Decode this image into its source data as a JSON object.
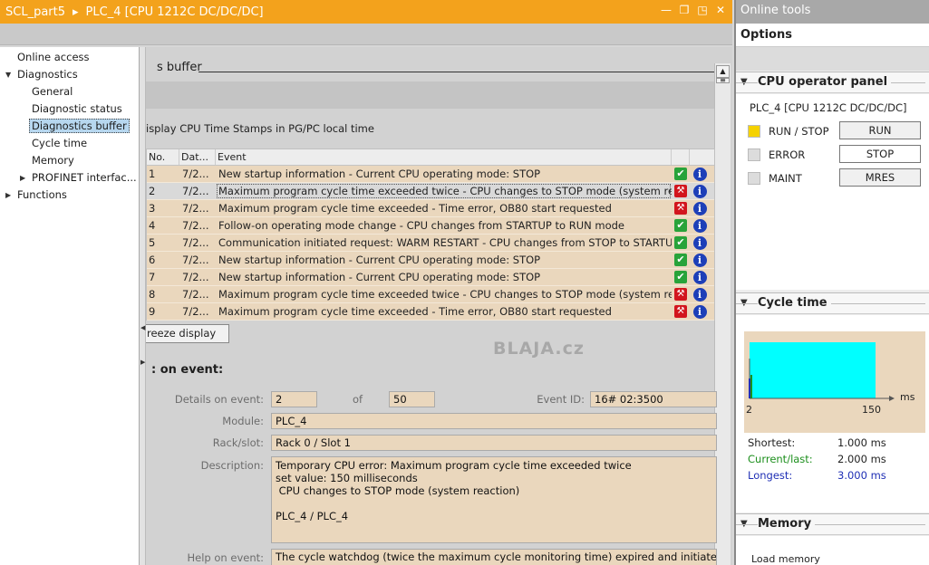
{
  "window": {
    "project": "SCL_part5",
    "device": "PLC_4 [CPU 1212C DC/DC/DC]",
    "controls": [
      "—",
      "❐",
      "◳",
      "✕"
    ]
  },
  "nav": {
    "items": [
      {
        "label": "Online access",
        "level": 0,
        "arrow": ""
      },
      {
        "label": "Diagnostics",
        "level": 0,
        "arrow": "▼"
      },
      {
        "label": "General",
        "level": 1,
        "arrow": ""
      },
      {
        "label": "Diagnostic status",
        "level": 1,
        "arrow": ""
      },
      {
        "label": "Diagnostics buffer",
        "level": 1,
        "arrow": "",
        "selected": true
      },
      {
        "label": "Cycle time",
        "level": 1,
        "arrow": ""
      },
      {
        "label": "Memory",
        "level": 1,
        "arrow": ""
      },
      {
        "label": "PROFINET interfac...",
        "level": 1,
        "arrow": "▶"
      },
      {
        "label": "Functions",
        "level": 0,
        "arrow": "▶"
      }
    ]
  },
  "main": {
    "section_title": "s buffer",
    "checkbox_label": "isplay CPU Time Stamps in PG/PC local time",
    "table": {
      "headers": {
        "no": "No.",
        "date": "Dat...",
        "event": "Event"
      },
      "rows": [
        {
          "no": "1",
          "date": "7/2...",
          "event": "New startup information  - Current CPU operating mode: STOP",
          "status": "ok"
        },
        {
          "no": "2",
          "date": "7/2...",
          "event": "Maximum program cycle time exceeded twice  - CPU changes to STOP mode (system reactio...",
          "status": "err",
          "selected": true
        },
        {
          "no": "3",
          "date": "7/2...",
          "event": "Maximum program cycle time exceeded  - Time error, OB80 start requested",
          "status": "err"
        },
        {
          "no": "4",
          "date": "7/2...",
          "event": "Follow-on operating mode change  - CPU changes from STARTUP to RUN mode",
          "status": "ok"
        },
        {
          "no": "5",
          "date": "7/2...",
          "event": "Communication initiated request: WARM RESTART  - CPU changes from STOP to STARTUP m...",
          "status": "ok"
        },
        {
          "no": "6",
          "date": "7/2...",
          "event": "New startup information  - Current CPU operating mode: STOP",
          "status": "ok"
        },
        {
          "no": "7",
          "date": "7/2...",
          "event": "New startup information  - Current CPU operating mode: STOP",
          "status": "ok"
        },
        {
          "no": "8",
          "date": "7/2...",
          "event": "Maximum program cycle time exceeded twice  - CPU changes to STOP mode (system reactio...",
          "status": "err"
        },
        {
          "no": "9",
          "date": "7/2...",
          "event": "Maximum program cycle time exceeded  - Time error, OB80 start requested",
          "status": "err"
        }
      ]
    },
    "freeze_button": "reeze display",
    "watermark": "BLAJA.cz",
    "details": {
      "title": ": on event:",
      "details_on_event_label": "Details on event:",
      "details_on_event_value": "2",
      "of_label": "of",
      "of_value": "50",
      "event_id_label": "Event ID:",
      "event_id_value": "16# 02:3500",
      "module_label": "Module:",
      "module_value": "PLC_4",
      "rack_label": "Rack/slot:",
      "rack_value": "Rack 0 / Slot 1",
      "description_label": "Description:",
      "description_value": "Temporary CPU error: Maximum program cycle time exceeded twice\nset value: 150 milliseconds\n CPU changes to STOP mode (system reaction)\n\nPLC_4 / PLC_4",
      "help_label": "Help on event:",
      "help_value": "The cycle watchdog (twice the maximum cycle monitoring time) expired and initiated an"
    }
  },
  "right": {
    "title": "Online tools",
    "options": "Options",
    "cpu_panel": {
      "title": "CPU operator panel",
      "cpu_name": "PLC_4 [CPU 1212C DC/DC/DC]",
      "leds": [
        {
          "label": "RUN / STOP",
          "color": "#f5d200",
          "button": "RUN"
        },
        {
          "label": "ERROR",
          "color": "#dcdcdc",
          "button": "STOP"
        },
        {
          "label": "MAINT",
          "color": "#dcdcdc",
          "button": "MRES"
        }
      ]
    },
    "cycle_time": {
      "title": "Cycle time",
      "unit": "ms",
      "axis_min": "2",
      "axis_max": "150",
      "shortest_label": "Shortest:",
      "shortest_value": "1.000 ms",
      "current_label": "Current/last:",
      "current_value": "2.000 ms",
      "longest_label": "Longest:",
      "longest_value": "3.000 ms",
      "colors": {
        "shortest": "#222222",
        "current": "#1d8f1d",
        "longest": "#1f2fb5",
        "bar": "#00ffff"
      }
    },
    "memory": {
      "title": "Memory",
      "load_memory": "Load memory"
    }
  }
}
